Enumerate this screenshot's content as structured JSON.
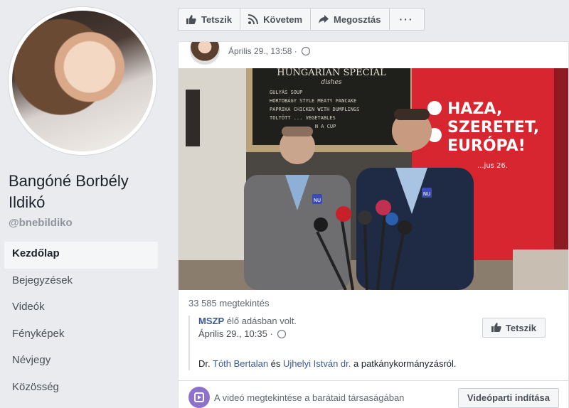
{
  "profile": {
    "name": "Bangóné Borbély Ildikó",
    "handle": "@bnebildiko"
  },
  "nav": {
    "items": [
      {
        "label": "Kezdőlap",
        "active": true
      },
      {
        "label": "Bejegyzések"
      },
      {
        "label": "Videók"
      },
      {
        "label": "Fényképek"
      },
      {
        "label": "Névjegy"
      },
      {
        "label": "Közösség"
      }
    ]
  },
  "actionbar": {
    "like": "Tetszik",
    "follow": "Követem",
    "share": "Megosztás",
    "more": "···"
  },
  "post": {
    "date": "Április 29., 13:58 ·",
    "views": "33 585 megtekintés",
    "video": {
      "menu_title": "HUNGARIAN SPECIAL",
      "menu_subtitle": "dishes",
      "menu_items": [
        "GULYÁS SOUP",
        "HORTOBÁGY STYLE MEATY PANCAKE",
        "PAPRIKA CHICKEN WITH DUMPLINGS",
        "TOLTÖTT ... VEGETABLES",
        "... N A CUP"
      ],
      "banner_line1": "HAZA,",
      "banner_line2": "SZERETET,",
      "banner_line3": "EURÓPA!",
      "banner_date": "...jus 26.",
      "badge": "NU"
    },
    "shared": {
      "source_name": "MSZP",
      "source_suffix": " élő adásban volt.",
      "date": "Április 29., 10:35 ·",
      "like": "Tetszik",
      "desc_prefix": "Dr. ",
      "person1": "Tóth Bertalan",
      "desc_mid": " és ",
      "person2": "Ujhelyi István dr.",
      "desc_suffix": " a patkánykormányzásról."
    },
    "watchparty": {
      "text": "A videó megtekintése a barátaid társaságában",
      "button": "Videóparti indítása"
    }
  },
  "colors": {
    "mszp_red": "#d7262f",
    "link_blue": "#385898",
    "page_bg": "#e9ebee"
  }
}
